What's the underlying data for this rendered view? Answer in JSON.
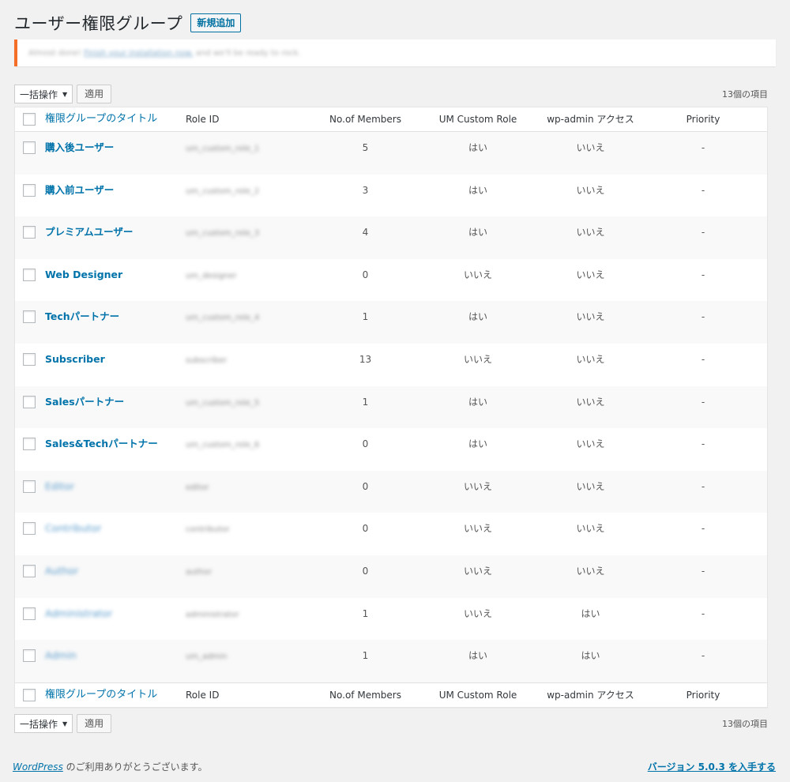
{
  "header": {
    "title": "ユーザー権限グループ",
    "add_new": "新規追加"
  },
  "notice": {
    "text_before": "Almost done!",
    "link_text": "Finish your installation now.",
    "text_after": "and we'll be ready to rock."
  },
  "tablenav": {
    "bulk_action": "一括操作",
    "apply": "適用",
    "item_count": "13個の項目"
  },
  "columns": {
    "title": "権限グループのタイトル",
    "role_id": "Role ID",
    "members": "No.of Members",
    "um_custom_role": "UM Custom Role",
    "wp_admin": "wp-admin アクセス",
    "priority": "Priority"
  },
  "rows": [
    {
      "title": "購入後ユーザー",
      "role_id": "um_custom_role_1",
      "members": "5",
      "um_custom_role": "はい",
      "wp_admin": "いいえ",
      "priority": "-"
    },
    {
      "title": "購入前ユーザー",
      "role_id": "um_custom_role_2",
      "members": "3",
      "um_custom_role": "はい",
      "wp_admin": "いいえ",
      "priority": "-"
    },
    {
      "title": "プレミアムユーザー",
      "role_id": "um_custom_role_3",
      "members": "4",
      "um_custom_role": "はい",
      "wp_admin": "いいえ",
      "priority": "-"
    },
    {
      "title": "Web Designer",
      "role_id": "um_designer",
      "members": "0",
      "um_custom_role": "いいえ",
      "wp_admin": "いいえ",
      "priority": "-"
    },
    {
      "title": "Techパートナー",
      "role_id": "um_custom_role_4",
      "members": "1",
      "um_custom_role": "はい",
      "wp_admin": "いいえ",
      "priority": "-"
    },
    {
      "title": "Subscriber",
      "role_id": "subscriber",
      "members": "13",
      "um_custom_role": "いいえ",
      "wp_admin": "いいえ",
      "priority": "-"
    },
    {
      "title": "Salesパートナー",
      "role_id": "um_custom_role_5",
      "members": "1",
      "um_custom_role": "はい",
      "wp_admin": "いいえ",
      "priority": "-"
    },
    {
      "title": "Sales&Techパートナー",
      "role_id": "um_custom_role_6",
      "members": "0",
      "um_custom_role": "はい",
      "wp_admin": "いいえ",
      "priority": "-"
    },
    {
      "title": "Editor",
      "role_id": "editor",
      "members": "0",
      "um_custom_role": "いいえ",
      "wp_admin": "いいえ",
      "priority": "-"
    },
    {
      "title": "Contributor",
      "role_id": "contributor",
      "members": "0",
      "um_custom_role": "いいえ",
      "wp_admin": "いいえ",
      "priority": "-"
    },
    {
      "title": "Author",
      "role_id": "author",
      "members": "0",
      "um_custom_role": "いいえ",
      "wp_admin": "いいえ",
      "priority": "-"
    },
    {
      "title": "Administrator",
      "role_id": "administrator",
      "members": "1",
      "um_custom_role": "いいえ",
      "wp_admin": "はい",
      "priority": "-"
    },
    {
      "title": "Admin",
      "role_id": "um_admin",
      "members": "1",
      "um_custom_role": "はい",
      "wp_admin": "はい",
      "priority": "-"
    }
  ],
  "footer": {
    "wordpress_link": "WordPress",
    "thanks_text": " のご利用ありがとうございます。",
    "version_link": "バージョン 5.0.3 を入手する"
  }
}
